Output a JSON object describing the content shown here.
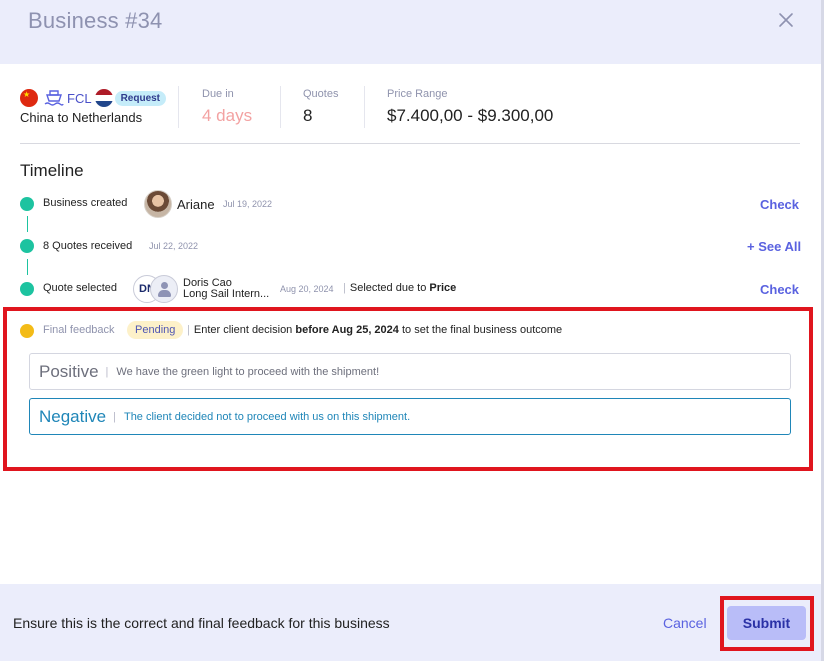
{
  "dialog": {
    "title": "Business #34"
  },
  "summary": {
    "mode": "FCL",
    "request_badge": "Request",
    "route": "China to Netherlands",
    "due_label": "Due in",
    "due_value": "4 days",
    "quotes_label": "Quotes",
    "quotes_value": "8",
    "price_label": "Price Range",
    "price_value": "$7.400,00 - $9.300,00",
    "icons": [
      "china-flag-icon",
      "ship-icon",
      "netherlands-flag-icon"
    ]
  },
  "timeline": {
    "title": "Timeline",
    "events": [
      {
        "label": "Business created",
        "user": "Ariane",
        "date": "Jul 19, 2022",
        "action": "Check"
      },
      {
        "label": "8 Quotes received",
        "date": "Jul 22, 2022",
        "action": "+ See All"
      },
      {
        "label": "Quote selected",
        "contact_name": "Doris Cao",
        "company": "Long Sail Intern...",
        "date": "Aug 20, 2024",
        "reason_prefix": "Selected due to",
        "reason": "Price",
        "action": "Check",
        "logo_text": "DN"
      },
      {
        "label": "Final feedback",
        "status": "Pending",
        "instruction_prefix": "Enter client decision",
        "instruction_bold": "before Aug 25, 2024",
        "instruction_suffix": "to set the final business outcome"
      }
    ]
  },
  "feedback_options": [
    {
      "title": "Positive",
      "description": "We have the green light to proceed with the shipment!",
      "selected": false
    },
    {
      "title": "Negative",
      "description": "The client decided not to proceed with us on this shipment.",
      "selected": true
    }
  ],
  "footer": {
    "message": "Ensure this is the correct and final feedback for this business",
    "cancel_label": "Cancel",
    "submit_label": "Submit"
  },
  "colors": {
    "accent": "#5a62e0",
    "timeline_done": "#1dc3a0",
    "timeline_pending": "#f3bb17",
    "selected_option": "#1f86b8",
    "highlight": "#e0151e"
  }
}
